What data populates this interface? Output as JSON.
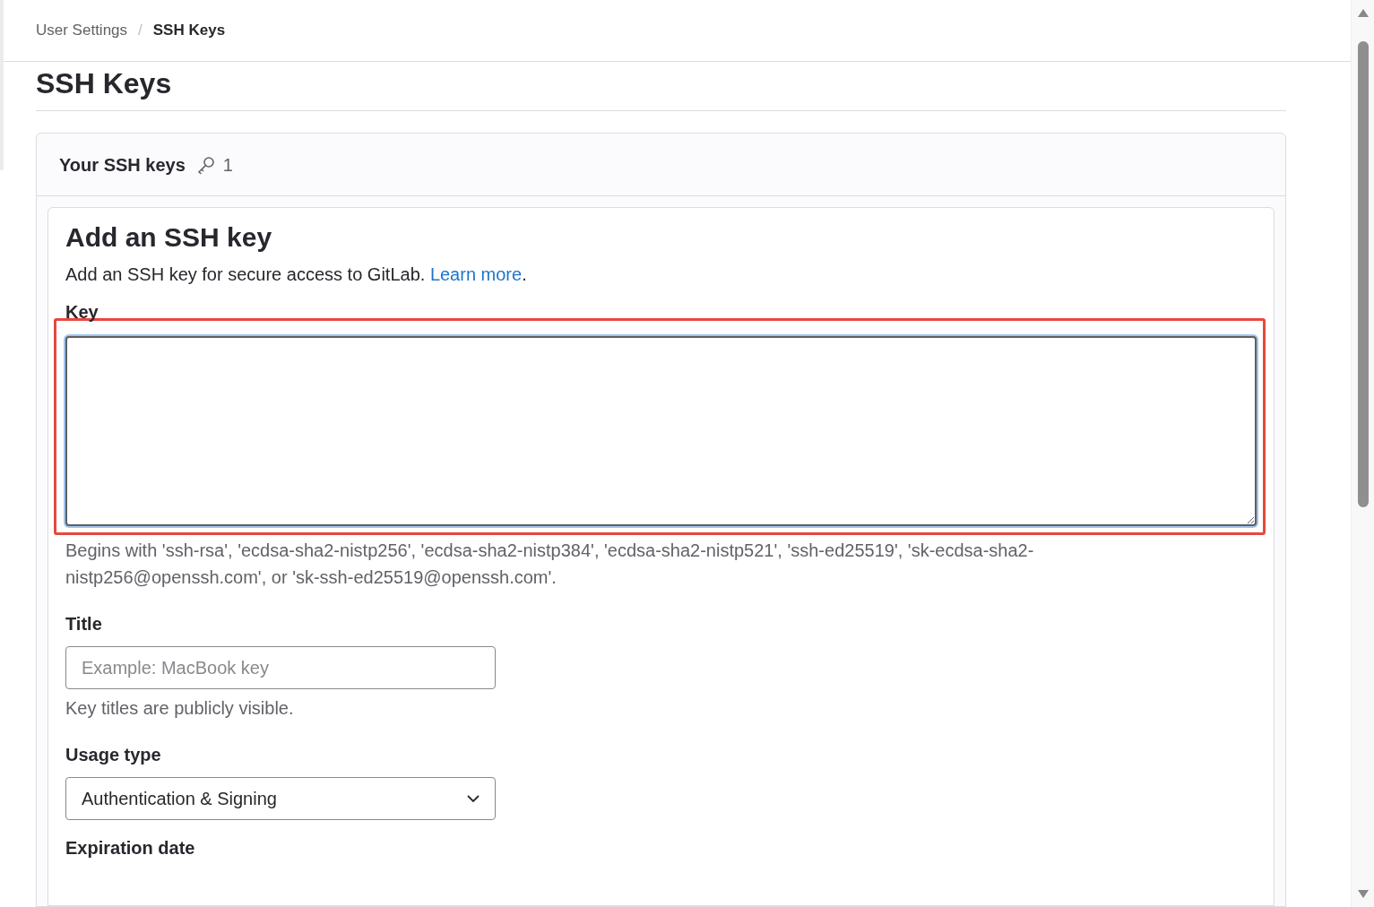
{
  "breadcrumb_separator": "/",
  "breadcrumb": [
    {
      "label": "User Settings",
      "current": false
    },
    {
      "label": "SSH Keys",
      "current": true
    }
  ],
  "page_title": "SSH Keys",
  "keys_card": {
    "title": "Your SSH keys",
    "count": "1"
  },
  "form": {
    "title": "Add an SSH key",
    "description": "Add an SSH key for secure access to GitLab.",
    "link": "Learn more",
    "link_suffix": ".",
    "key_field": {
      "label": "Key",
      "focused": true,
      "hint": "Begins with 'ssh-rsa', 'ecdsa-sha2-nistp256', 'ecdsa-sha2-nistp384', 'ecdsa-sha2-nistp521', 'ssh-ed25519', 'sk-ecdsa-sha2-nistp256@openssh.com', or 'sk-ssh-ed25519@openssh.com'."
    },
    "title_field": {
      "label": "Title",
      "placeholder": "Example: MacBook key",
      "hint": "Key titles are publicly visible."
    },
    "usage_field": {
      "label": "Usage type",
      "value": "Authentication & Signing"
    },
    "expiration_field": {
      "label": "Expiration date"
    }
  }
}
